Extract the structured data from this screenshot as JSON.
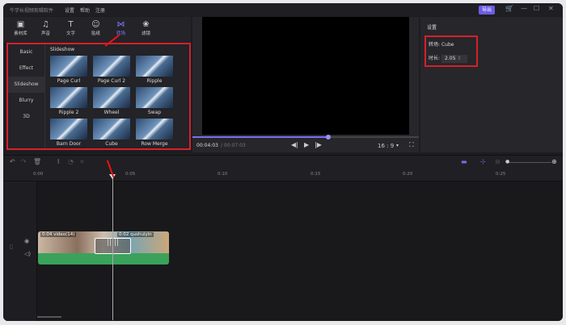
{
  "titlebar": {
    "app": "牛学长视频剪辑软件",
    "menus": [
      "设置",
      "帮助",
      "注册"
    ],
    "export": "导出"
  },
  "toolbar": [
    {
      "label": "素材库",
      "icon": "media-icon"
    },
    {
      "label": "声音",
      "icon": "music-icon"
    },
    {
      "label": "文字",
      "icon": "text-icon"
    },
    {
      "label": "贴纸",
      "icon": "sticker-icon"
    },
    {
      "label": "转场",
      "icon": "transition-icon",
      "active": true
    },
    {
      "label": "滤镜",
      "icon": "filter-icon"
    }
  ],
  "categories": [
    "Basic",
    "Effect",
    "Slideshow",
    "Blurry",
    "3D"
  ],
  "selected_category": "Slideshow",
  "grid_title": "Slideshow",
  "transitions": [
    "Page Curl",
    "Page Curl 2",
    "Ripple",
    "Ripple 2",
    "Wheel",
    "Swap",
    "Barn Door",
    "Cube",
    "Row Merge"
  ],
  "preview": {
    "current": "00:04:03",
    "total": "/ 00:07:03",
    "ratio": "16 : 9",
    "progress": 0.6
  },
  "settings": {
    "header": "设置",
    "transition_label": "转场:",
    "transition_value": "Cube",
    "duration_label": "时长:",
    "duration_value": "2.0S"
  },
  "ruler": [
    "0:00",
    "0:05",
    "0:10",
    "0:15",
    "0:20",
    "0:25"
  ],
  "clips": [
    {
      "time": "0:04",
      "name": "video(14)"
    },
    {
      "time": "0:02",
      "name": "qushuiyin"
    }
  ],
  "accent": "#6b5ce7"
}
